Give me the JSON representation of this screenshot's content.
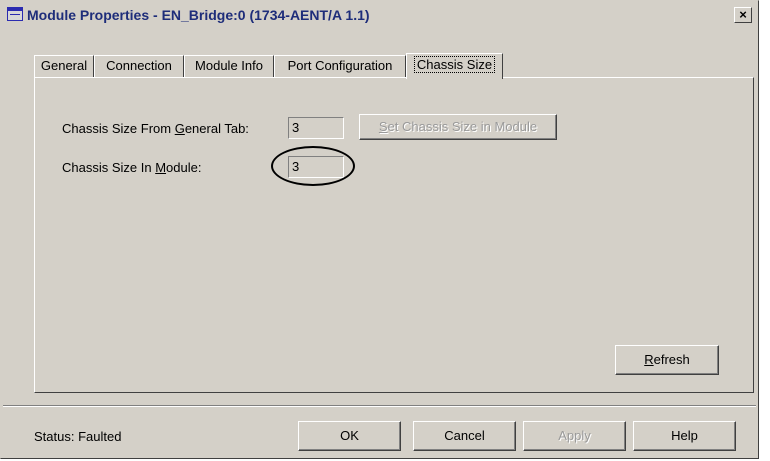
{
  "window": {
    "title": "Module Properties - EN_Bridge:0 (1734-AENT/A 1.1)",
    "close_glyph": "×"
  },
  "tabs": [
    {
      "label": "General",
      "active": false
    },
    {
      "label": "Connection",
      "active": false
    },
    {
      "label": "Module Info",
      "active": false
    },
    {
      "label": "Port Configuration",
      "active": false
    },
    {
      "label": "Chassis Size",
      "active": true
    }
  ],
  "chassis": {
    "from_general_label_pre": "Chassis Size From ",
    "from_general_label_accel": "G",
    "from_general_label_post": "eneral Tab:",
    "from_general_value": "3",
    "in_module_label_pre": "Chassis Size In ",
    "in_module_label_accel": "M",
    "in_module_label_post": "odule:",
    "in_module_value": "3",
    "set_button_accel": "S",
    "set_button_rest": "et Chassis Size in Module",
    "refresh_accel": "R",
    "refresh_rest": "efresh"
  },
  "footer": {
    "status": "Status:  Faulted",
    "ok": "OK",
    "cancel": "Cancel",
    "apply": "Apply",
    "help": "Help"
  }
}
